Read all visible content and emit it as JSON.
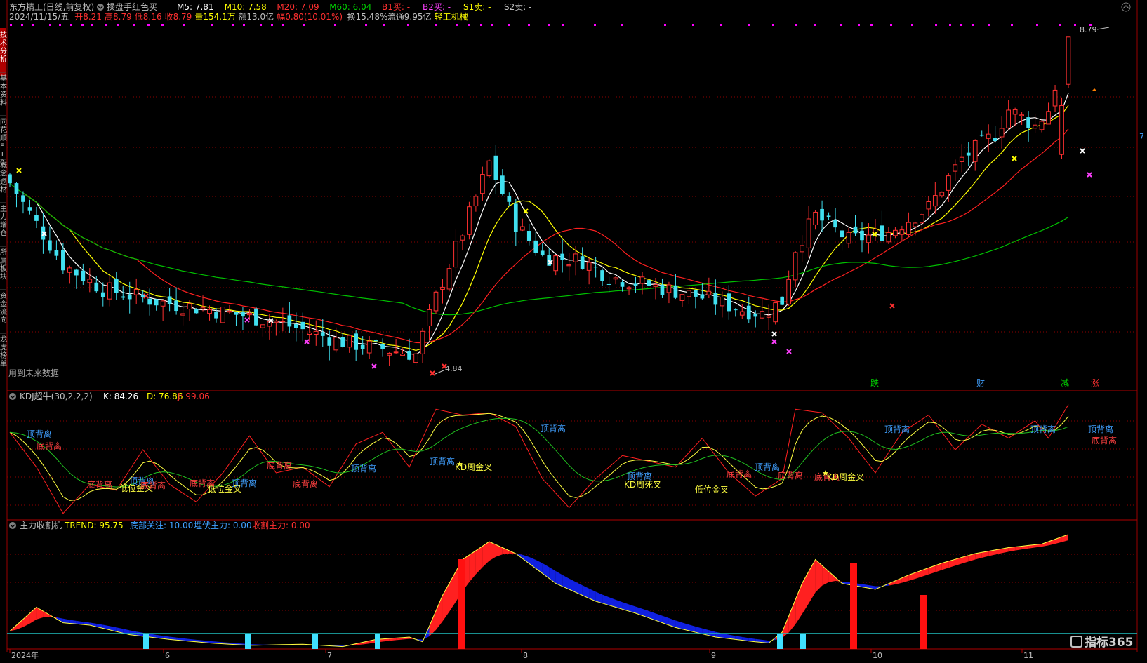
{
  "header": {
    "title": "东方精工(日线,前复权)",
    "indicator_name": "操盘手红色买",
    "ma_items": [
      {
        "label": "M5: 7.81",
        "color": "#ffffff"
      },
      {
        "label": "M10: 7.58",
        "color": "#ffff00"
      },
      {
        "label": "M20: 7.09",
        "color": "#ff3030"
      },
      {
        "label": "M60: 6.04",
        "color": "#00d000"
      },
      {
        "label": "B1买: -",
        "color": "#ff3030"
      },
      {
        "label": "B2买: -",
        "color": "#ff40ff"
      },
      {
        "label": "S1卖: -",
        "color": "#ffff00"
      },
      {
        "label": "S2卖: -",
        "color": "#c0c0c0"
      }
    ],
    "info_line": [
      {
        "label": "2024/11/15/五",
        "color": "#c0c0c0"
      },
      {
        "label": "开8.21",
        "color": "#ff3030"
      },
      {
        "label": "高8.79",
        "color": "#ff3030"
      },
      {
        "label": "低8.16",
        "color": "#ff3030"
      },
      {
        "label": "收8.79",
        "color": "#ff3030"
      },
      {
        "label": "量154.1万",
        "color": "#ffff00"
      },
      {
        "label": "额13.0亿",
        "color": "#c0c0c0"
      },
      {
        "label": "幅0.80(10.01%)",
        "color": "#ff3030"
      },
      {
        "label": "换15.48%",
        "color": "#c0c0c0"
      },
      {
        "label": "流通9.95亿",
        "color": "#c0c0c0"
      },
      {
        "label": "轻工机械",
        "color": "#ffff00"
      }
    ]
  },
  "left_tabs": [
    "技术分析",
    "基本资料",
    "同花顺F10",
    "概念题材",
    "主力增仓",
    "所属板块",
    "资金流向",
    "龙虎榜单"
  ],
  "main_panel": {
    "price_high_label": "8.79",
    "price_low_label": "4.84",
    "future_data_note": "用到未来数据",
    "bottom_markers": [
      {
        "label": "跌",
        "color": "#00d000"
      },
      {
        "label": "财",
        "color": "#40a0ff"
      },
      {
        "label": "减",
        "color": "#00d000"
      },
      {
        "label": "涨",
        "color": "#ff3030"
      }
    ],
    "right_edge_label": "7"
  },
  "kdj_panel": {
    "title": "KDJ超牛(30,2,2,2)",
    "k_label": "K: 84.26",
    "d_label": "D: 76.86",
    "j_label": "J: 99.06",
    "annotations": [
      {
        "text": "顶背离",
        "color": "#40a0ff"
      },
      {
        "text": "底背离",
        "color": "#ff4040"
      },
      {
        "text": "底背离",
        "color": "#ff4040"
      },
      {
        "text": "顶背离",
        "color": "#40a0ff"
      },
      {
        "text": "低位金叉",
        "color": "#ffff40"
      },
      {
        "text": "底背离",
        "color": "#ff4040"
      },
      {
        "text": "低位金叉",
        "color": "#ffff40"
      },
      {
        "text": "底背离",
        "color": "#ff4040"
      },
      {
        "text": "顶背离",
        "color": "#40a0ff"
      },
      {
        "text": "底背离",
        "color": "#ff4040"
      },
      {
        "text": "底背离",
        "color": "#ff4040"
      },
      {
        "text": "顶背离",
        "color": "#40a0ff"
      },
      {
        "text": "顶背离",
        "color": "#40a0ff"
      },
      {
        "text": "KD周金叉",
        "color": "#ffff40"
      },
      {
        "text": "顶背离",
        "color": "#40a0ff"
      },
      {
        "text": "顶背离",
        "color": "#40a0ff"
      },
      {
        "text": "KD周死叉",
        "color": "#ffff40"
      },
      {
        "text": "底背离",
        "color": "#ff4040"
      },
      {
        "text": "低位金叉",
        "color": "#ffff40"
      },
      {
        "text": "底背离",
        "color": "#ff4040"
      },
      {
        "text": "顶背离",
        "color": "#40a0ff"
      },
      {
        "text": "底背离",
        "color": "#ff4040"
      },
      {
        "text": "KD周金叉",
        "color": "#ffff40"
      },
      {
        "text": "顶背离",
        "color": "#40a0ff"
      },
      {
        "text": "顶背离",
        "color": "#40a0ff"
      },
      {
        "text": "顶背离",
        "color": "#40a0ff"
      },
      {
        "text": "底背离",
        "color": "#ff4040"
      }
    ]
  },
  "trend_panel": {
    "title": "主力收割机",
    "trend_label": "TREND: 95.75",
    "bottom_focus_label": "底部关注: 10.00",
    "ambush_label": "埋伏主力: 0.00",
    "harvest_label": "收割主力: 0.00"
  },
  "x_axis": {
    "labels": [
      "2024年",
      "6",
      "7",
      "8",
      "9",
      "10",
      "11"
    ]
  },
  "watermark": "指标365",
  "chart_data": {
    "type": "candlestick",
    "title": "东方精工(日线,前复权)",
    "last_bar": {
      "date": "2024/11/15",
      "open": 8.21,
      "high": 8.79,
      "low": 8.16,
      "close": 8.79
    },
    "period_high": 8.79,
    "period_low": 4.84,
    "moving_averages": {
      "M5": 7.81,
      "M10": 7.58,
      "M20": 7.09,
      "M60": 6.04
    },
    "kdj": {
      "K": 84.26,
      "D": 76.86,
      "J": 99.06
    },
    "trend": 95.75,
    "x_tick_labels": [
      "2024年",
      "6",
      "7",
      "8",
      "9",
      "10",
      "11"
    ]
  },
  "colors": {
    "up": "#ff3030",
    "down": "#40e0f0",
    "m5": "#ffffff",
    "m10": "#ffff00",
    "m20": "#ff2020",
    "m60": "#00c000",
    "grid": "#8b0000"
  }
}
